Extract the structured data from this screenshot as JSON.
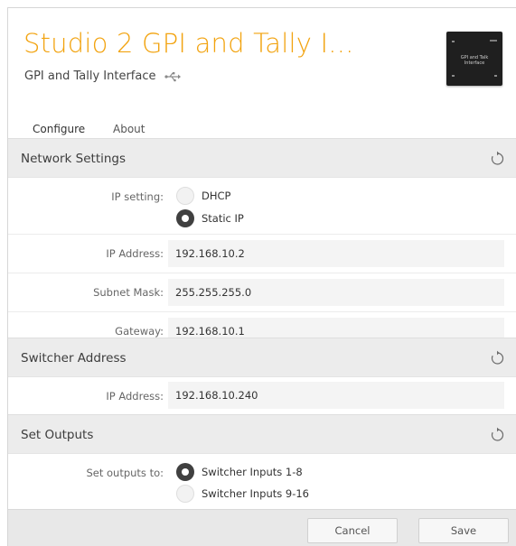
{
  "header": {
    "title": "Studio 2 GPI and Tally I...",
    "subtitle": "GPI and Tally Interface",
    "connection_icon": "usb-icon",
    "device_image_label": "GPI and Talk Interface"
  },
  "tabs": [
    {
      "label": "Configure",
      "active": true
    },
    {
      "label": "About",
      "active": false
    }
  ],
  "network_settings": {
    "title": "Network Settings",
    "ip_setting_label": "IP setting:",
    "options": [
      {
        "label": "DHCP",
        "selected": false
      },
      {
        "label": "Static IP",
        "selected": true
      }
    ],
    "ip_address_label": "IP Address:",
    "ip_address": "192.168.10.2",
    "subnet_mask_label": "Subnet Mask:",
    "subnet_mask": "255.255.255.0",
    "gateway_label": "Gateway:",
    "gateway": "192.168.10.1"
  },
  "switcher_address": {
    "title": "Switcher Address",
    "ip_address_label": "IP Address:",
    "ip_address": "192.168.10.240"
  },
  "set_outputs": {
    "title": "Set Outputs",
    "label": "Set outputs to:",
    "options": [
      {
        "label": "Switcher Inputs 1-8",
        "selected": true
      },
      {
        "label": "Switcher Inputs 9-16",
        "selected": false
      }
    ]
  },
  "footer": {
    "cancel_label": "Cancel",
    "save_label": "Save"
  },
  "colors": {
    "accent": "#f2a30f",
    "section_background": "#ececec",
    "field_background": "#f4f4f4"
  }
}
